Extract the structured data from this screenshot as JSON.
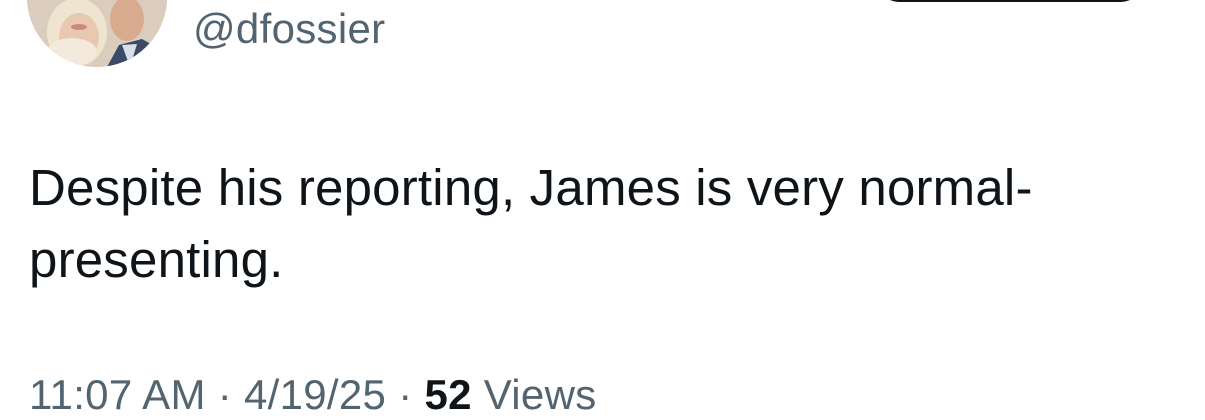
{
  "user": {
    "handle": "@dfossier"
  },
  "tweet": {
    "text_line_1": "Despite his reporting, James is very normal-",
    "text_line_2": "presenting."
  },
  "meta": {
    "time": "11:07 AM",
    "separator": " · ",
    "date": "4/19/25",
    "views_count": "52",
    "views_label": " Views"
  },
  "colors": {
    "text_primary": "#0f1419",
    "text_secondary": "#536471",
    "button_dark": "#0f1419"
  }
}
